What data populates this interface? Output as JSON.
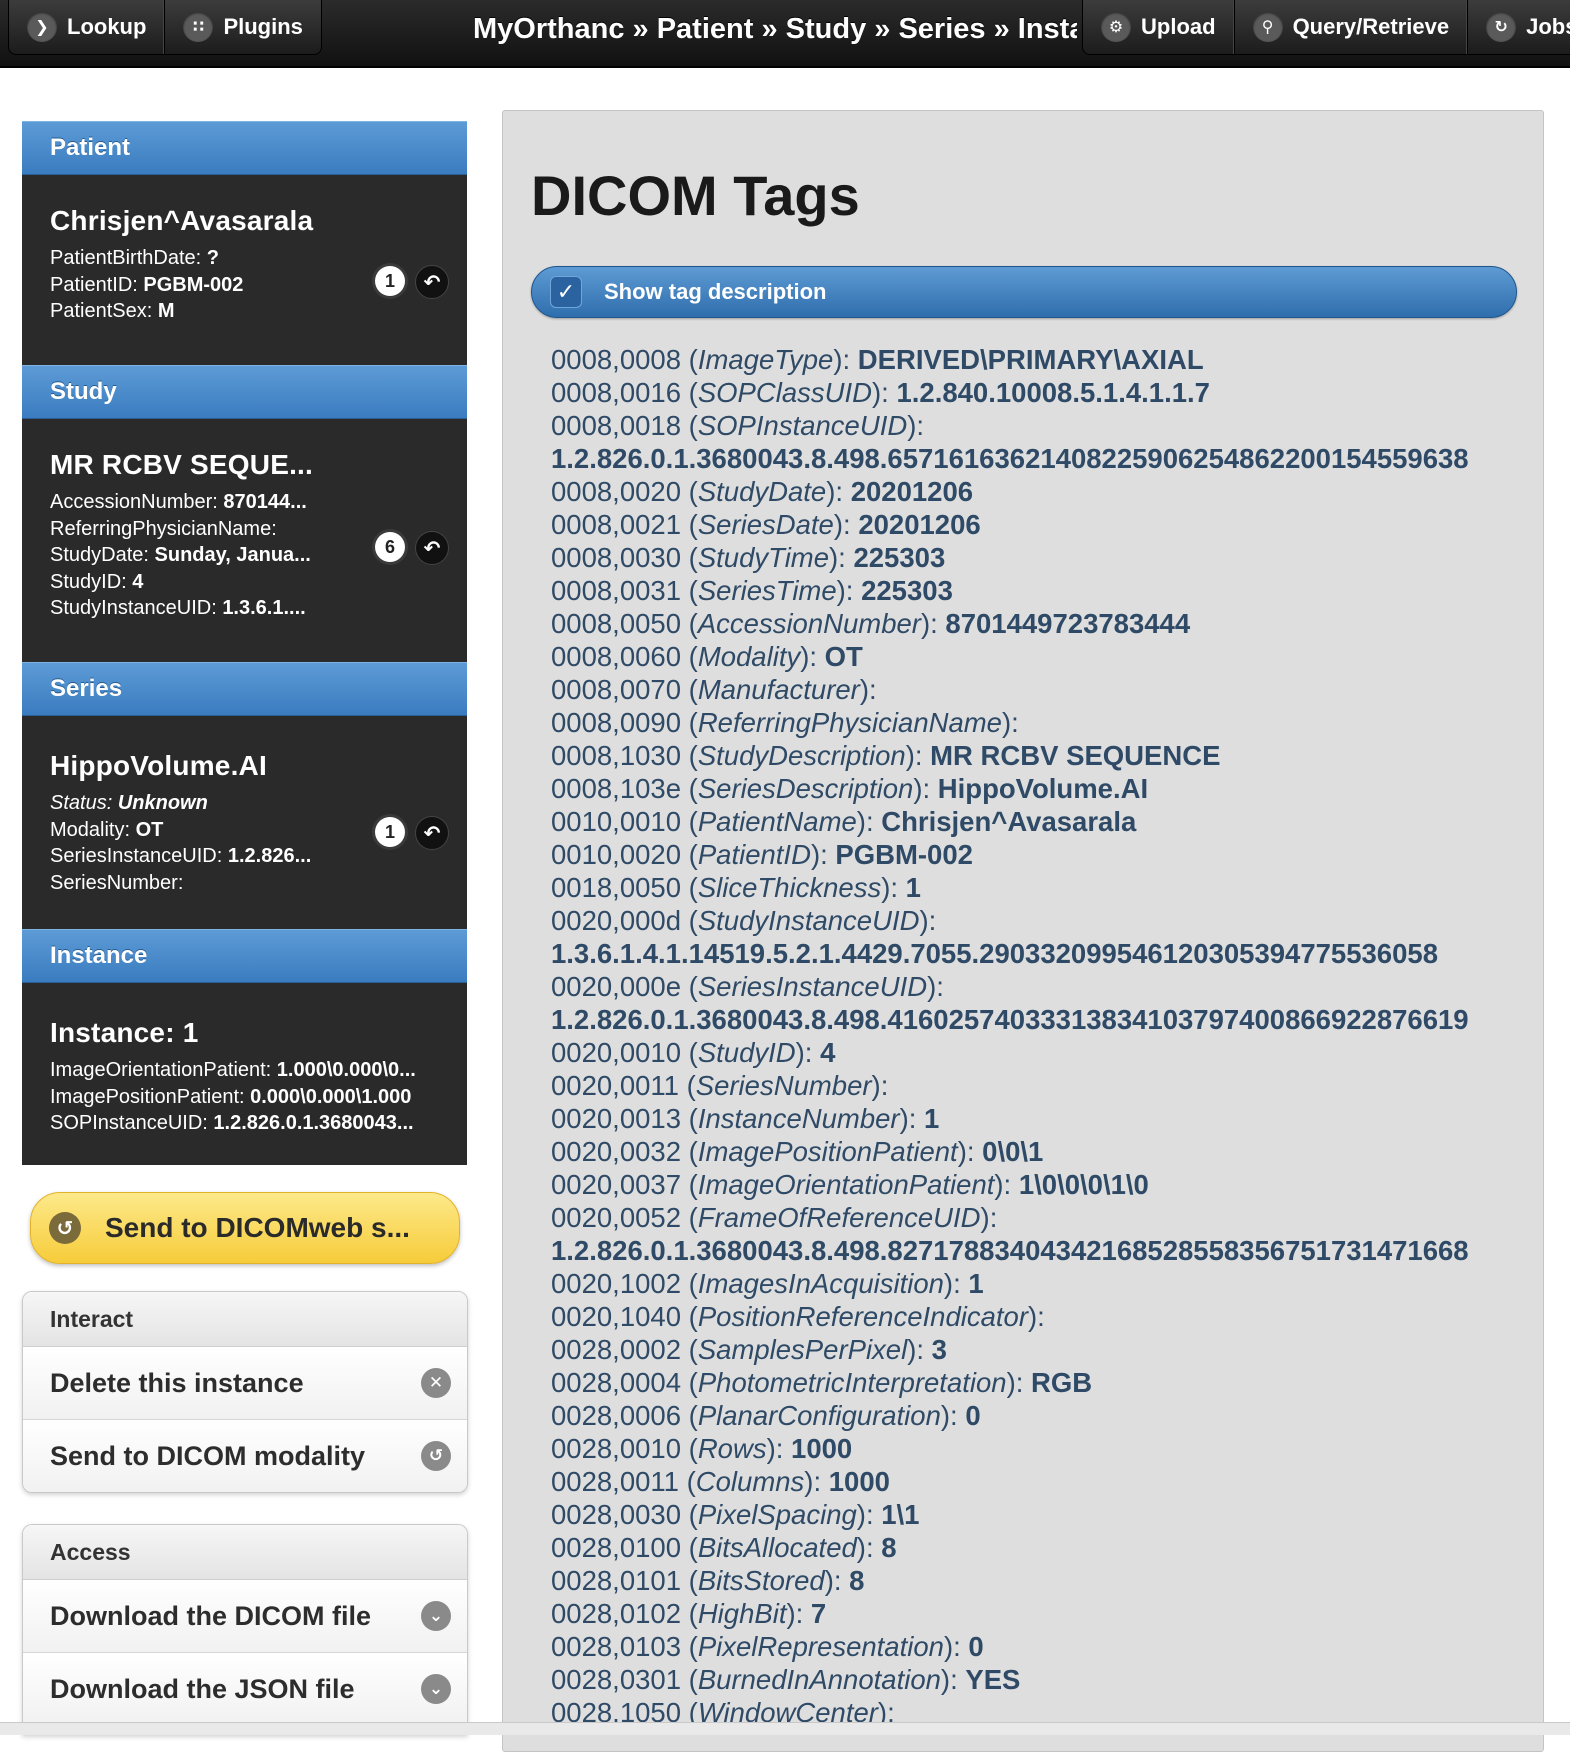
{
  "topbar": {
    "left_buttons": [
      {
        "label": "Lookup",
        "icon": "chevron-right-icon"
      },
      {
        "label": "Plugins",
        "icon": "grid-icon"
      }
    ],
    "title": "MyOrthanc » Patient » Study » Series » Insta...",
    "right_buttons": [
      {
        "label": "Upload",
        "icon": "gear-icon"
      },
      {
        "label": "Query/Retrieve",
        "icon": "search-icon"
      },
      {
        "label": "Jobs",
        "icon": "refresh-icon"
      }
    ]
  },
  "patient": {
    "header": "Patient",
    "name": "Chrisjen^Avasarala",
    "fields": [
      {
        "k": "PatientBirthDate: ",
        "v": "?"
      },
      {
        "k": "PatientID: ",
        "v": "PGBM-002"
      },
      {
        "k": "PatientSex: ",
        "v": "M"
      }
    ],
    "count": "1"
  },
  "study": {
    "header": "Study",
    "name": "MR RCBV SEQUE...",
    "fields": [
      {
        "k": "AccessionNumber: ",
        "v": "870144..."
      },
      {
        "k": "ReferringPhysicianName: ",
        "v": ""
      },
      {
        "k": "StudyDate: ",
        "v": "Sunday, Janua..."
      },
      {
        "k": "StudyID: ",
        "v": "4"
      },
      {
        "k": "StudyInstanceUID: ",
        "v": "1.3.6.1...."
      }
    ],
    "count": "6"
  },
  "series": {
    "header": "Series",
    "name": "HippoVolume.AI",
    "status_k": "Status: ",
    "status_v": "Unknown",
    "fields": [
      {
        "k": "Modality: ",
        "v": "OT"
      },
      {
        "k": "SeriesInstanceUID: ",
        "v": "1.2.826..."
      },
      {
        "k": "SeriesNumber: ",
        "v": ""
      }
    ],
    "count": "1"
  },
  "instance": {
    "header": "Instance",
    "name": "Instance: 1",
    "fields": [
      {
        "k": "ImageOrientationPatient: ",
        "v": "1.000\\0.000\\0..."
      },
      {
        "k": "ImagePositionPatient: ",
        "v": "0.000\\0.000\\1.000"
      },
      {
        "k": "SOPInstanceUID: ",
        "v": "1.2.826.0.1.3680043..."
      }
    ]
  },
  "dicomweb_button": "Send to DICOMweb s...",
  "interact": {
    "header": "Interact",
    "items": [
      "Delete this instance",
      "Send to DICOM modality"
    ]
  },
  "access": {
    "header": "Access",
    "items": [
      "Download the DICOM file",
      "Download the JSON file"
    ]
  },
  "dicom_tags": {
    "title": "DICOM Tags",
    "show_description_label": "Show tag description",
    "show_description_checked": true,
    "tags": [
      {
        "id": "0008,0008",
        "name": "ImageType",
        "value": "DERIVED\\PRIMARY\\AXIAL"
      },
      {
        "id": "0008,0016",
        "name": "SOPClassUID",
        "value": "1.2.840.10008.5.1.4.1.1.7"
      },
      {
        "id": "0008,0018",
        "name": "SOPInstanceUID",
        "value": "1.2.826.0.1.3680043.8.498.65716163621408225906254862200154559638",
        "wrap": true
      },
      {
        "id": "0008,0020",
        "name": "StudyDate",
        "value": "20201206"
      },
      {
        "id": "0008,0021",
        "name": "SeriesDate",
        "value": "20201206"
      },
      {
        "id": "0008,0030",
        "name": "StudyTime",
        "value": "225303"
      },
      {
        "id": "0008,0031",
        "name": "SeriesTime",
        "value": "225303"
      },
      {
        "id": "0008,0050",
        "name": "AccessionNumber",
        "value": "8701449723783444"
      },
      {
        "id": "0008,0060",
        "name": "Modality",
        "value": "OT"
      },
      {
        "id": "0008,0070",
        "name": "Manufacturer",
        "value": ""
      },
      {
        "id": "0008,0090",
        "name": "ReferringPhysicianName",
        "value": ""
      },
      {
        "id": "0008,1030",
        "name": "StudyDescription",
        "value": "MR RCBV SEQUENCE"
      },
      {
        "id": "0008,103e",
        "name": "SeriesDescription",
        "value": "HippoVolume.AI"
      },
      {
        "id": "0010,0010",
        "name": "PatientName",
        "value": "Chrisjen^Avasarala"
      },
      {
        "id": "0010,0020",
        "name": "PatientID",
        "value": "PGBM-002"
      },
      {
        "id": "0018,0050",
        "name": "SliceThickness",
        "value": "1"
      },
      {
        "id": "0020,000d",
        "name": "StudyInstanceUID",
        "value": "1.3.6.1.4.1.14519.5.2.1.4429.7055.290332099546120305394775536058",
        "wrap": true
      },
      {
        "id": "0020,000e",
        "name": "SeriesInstanceUID",
        "value": "1.2.826.0.1.3680043.8.498.41602574033313834103797400866922876619",
        "wrap": true
      },
      {
        "id": "0020,0010",
        "name": "StudyID",
        "value": "4"
      },
      {
        "id": "0020,0011",
        "name": "SeriesNumber",
        "value": ""
      },
      {
        "id": "0020,0013",
        "name": "InstanceNumber",
        "value": "1"
      },
      {
        "id": "0020,0032",
        "name": "ImagePositionPatient",
        "value": "0\\0\\1"
      },
      {
        "id": "0020,0037",
        "name": "ImageOrientationPatient",
        "value": "1\\0\\0\\0\\1\\0"
      },
      {
        "id": "0020,0052",
        "name": "FrameOfReferenceUID",
        "value": "1.2.826.0.1.3680043.8.498.82717883404342168528558356751731471668",
        "wrap": true
      },
      {
        "id": "0020,1002",
        "name": "ImagesInAcquisition",
        "value": "1"
      },
      {
        "id": "0020,1040",
        "name": "PositionReferenceIndicator",
        "value": ""
      },
      {
        "id": "0028,0002",
        "name": "SamplesPerPixel",
        "value": "3"
      },
      {
        "id": "0028,0004",
        "name": "PhotometricInterpretation",
        "value": "RGB"
      },
      {
        "id": "0028,0006",
        "name": "PlanarConfiguration",
        "value": "0"
      },
      {
        "id": "0028,0010",
        "name": "Rows",
        "value": "1000"
      },
      {
        "id": "0028,0011",
        "name": "Columns",
        "value": "1000"
      },
      {
        "id": "0028,0030",
        "name": "PixelSpacing",
        "value": "1\\1"
      },
      {
        "id": "0028,0100",
        "name": "BitsAllocated",
        "value": "8"
      },
      {
        "id": "0028,0101",
        "name": "BitsStored",
        "value": "8"
      },
      {
        "id": "0028,0102",
        "name": "HighBit",
        "value": "7"
      },
      {
        "id": "0028,0103",
        "name": "PixelRepresentation",
        "value": "0"
      },
      {
        "id": "0028,0301",
        "name": "BurnedInAnnotation",
        "value": "YES"
      },
      {
        "id": "0028,1050",
        "name": "WindowCenter",
        "value": ""
      }
    ]
  }
}
